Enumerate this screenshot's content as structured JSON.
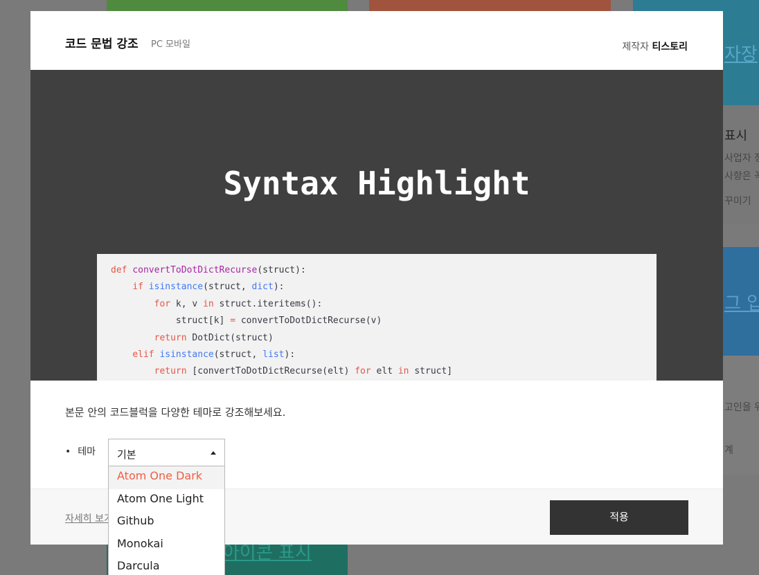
{
  "background": {
    "right_texts": [
      "자장",
      "표시",
      "사업자 정",
      "사항은 꼭",
      "꾸미기",
      "그 입",
      "고인을 위",
      "계"
    ],
    "bottom_text": "아이콘 표시"
  },
  "modal": {
    "title": "코드 문법 강조",
    "platform": "PC 모바일",
    "maker_label": "제작자",
    "maker_name": "티스토리",
    "preview": {
      "title": "Syntax Highlight",
      "code": [
        "def convertToDotDictRecurse(struct):",
        "    if isinstance(struct, dict):",
        "        for k, v in struct.iteritems():",
        "            struct[k] = convertToDotDictRecurse(v)",
        "        return DotDict(struct)",
        "    elif isinstance(struct, list):",
        "        return [convertToDotDictRecurse(elt) for elt in struct]"
      ]
    },
    "description": "본문 안의 코드블럭을 다양한 테마로 강조해보세요.",
    "theme_label": "테마",
    "theme_selected": "기본",
    "theme_options": [
      "Atom One Dark",
      "Atom One Light",
      "Github",
      "Monokai",
      "Darcula"
    ],
    "more_link": "자세히 보기",
    "apply_label": "적용"
  },
  "colors": {
    "accent": "#ef5d42",
    "button": "#333333",
    "preview_bg": "#404040"
  }
}
